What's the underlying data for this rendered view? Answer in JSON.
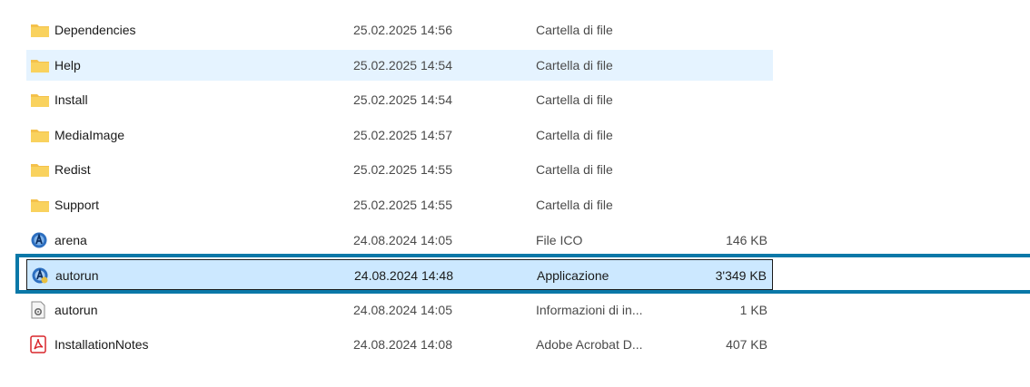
{
  "files": [
    {
      "name": "Dependencies",
      "date": "25.02.2025 14:56",
      "type": "Cartella di file",
      "size": "",
      "icon": "folder-icon",
      "state": ""
    },
    {
      "name": "Help",
      "date": "25.02.2025 14:54",
      "type": "Cartella di file",
      "size": "",
      "icon": "folder-icon",
      "state": "hover"
    },
    {
      "name": "Install",
      "date": "25.02.2025 14:54",
      "type": "Cartella di file",
      "size": "",
      "icon": "folder-icon",
      "state": ""
    },
    {
      "name": "MediaImage",
      "date": "25.02.2025 14:57",
      "type": "Cartella di file",
      "size": "",
      "icon": "folder-icon",
      "state": ""
    },
    {
      "name": "Redist",
      "date": "25.02.2025 14:55",
      "type": "Cartella di file",
      "size": "",
      "icon": "folder-icon",
      "state": ""
    },
    {
      "name": "Support",
      "date": "25.02.2025 14:55",
      "type": "Cartella di file",
      "size": "",
      "icon": "folder-icon",
      "state": ""
    },
    {
      "name": "arena",
      "date": "24.08.2024 14:05",
      "type": "File ICO",
      "size": "146 KB",
      "icon": "arena-ico-icon",
      "state": ""
    },
    {
      "name": "autorun",
      "date": "24.08.2024 14:48",
      "type": "Applicazione",
      "size": "3'349 KB",
      "icon": "arena-app-icon",
      "state": "selected"
    },
    {
      "name": "autorun",
      "date": "24.08.2024 14:05",
      "type": "Informazioni di in...",
      "size": "1 KB",
      "icon": "settings-file-icon",
      "state": ""
    },
    {
      "name": "InstallationNotes",
      "date": "24.08.2024 14:08",
      "type": "Adobe Acrobat D...",
      "size": "407 KB",
      "icon": "pdf-icon",
      "state": ""
    }
  ],
  "colors": {
    "folder": "#f4c14b",
    "hover": "#e5f3ff",
    "selected": "#cce8ff",
    "highlight_box": "#0a78a8",
    "pdf": "#d9262c"
  }
}
